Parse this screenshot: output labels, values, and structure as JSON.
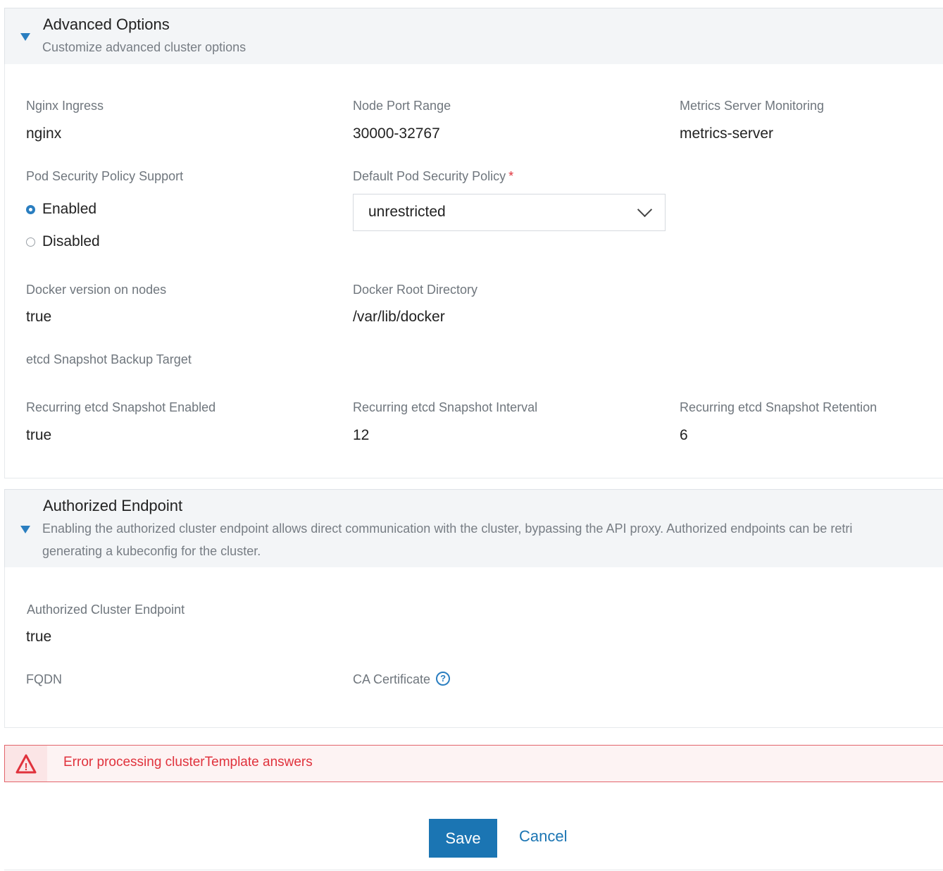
{
  "advanced": {
    "title": "Advanced Options",
    "description": "Customize advanced cluster options",
    "nginx_label": "Nginx Ingress",
    "nginx_value": "nginx",
    "nodeport_label": "Node Port Range",
    "nodeport_value": "30000-32767",
    "metrics_label": "Metrics Server Monitoring",
    "metrics_value": "metrics-server",
    "psp_label": "Pod Security Policy Support",
    "psp_options": [
      "Enabled",
      "Disabled"
    ],
    "psp_selected": "Enabled",
    "default_psp_label": "Default Pod Security Policy",
    "default_psp_required": "*",
    "default_psp_value": "unrestricted",
    "docker_version_label": "Docker version on nodes",
    "docker_version_value": "true",
    "docker_root_label": "Docker Root Directory",
    "docker_root_value": "/var/lib/docker",
    "etcd_backup_label": "etcd Snapshot Backup Target",
    "recurring_enabled_label": "Recurring etcd Snapshot Enabled",
    "recurring_enabled_value": "true",
    "recurring_interval_label": "Recurring etcd Snapshot Interval",
    "recurring_interval_value": "12",
    "recurring_retention_label": "Recurring etcd Snapshot Retention",
    "recurring_retention_value": "6"
  },
  "authorized": {
    "title": "Authorized Endpoint",
    "description_line1": "Enabling the authorized cluster endpoint allows direct communication with the cluster, bypassing the API proxy. Authorized endpoints can be retri",
    "description_line2": "generating a kubeconfig for the cluster.",
    "endpoint_label": "Authorized Cluster Endpoint",
    "endpoint_value": "true",
    "fqdn_label": "FQDN",
    "ca_label": "CA Certificate",
    "ca_help_icon": "?"
  },
  "error": {
    "message": "Error processing clusterTemplate answers",
    "icon": "!"
  },
  "actions": {
    "save": "Save",
    "cancel": "Cancel"
  },
  "colors": {
    "accent": "#2a7ec0",
    "primary_button": "#1b75b3",
    "error": "#e0323c"
  }
}
